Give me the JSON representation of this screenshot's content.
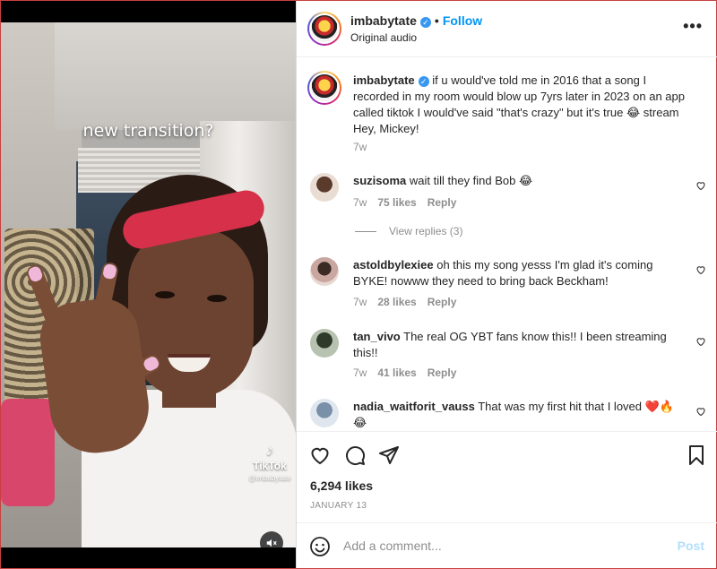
{
  "post": {
    "author": "imbabytate",
    "audio": "Original audio",
    "follow_label": "Follow",
    "dot": "•",
    "more_label": "•••"
  },
  "media": {
    "overlay_text": "new transition?",
    "watermark_brand": "TikTok",
    "watermark_user": "@imbabytate"
  },
  "caption": {
    "username": "imbabytate",
    "text": "if u would've told me in 2016 that a song I recorded in my room would blow up 7yrs later in 2023 on an app called tiktok I would've said \"that's crazy\" but it's true 😂 stream Hey, Mickey!",
    "time": "7w"
  },
  "comments": [
    {
      "username": "suzisoma",
      "text": "wait till they find Bob 😂",
      "time": "7w",
      "likes": "75 likes",
      "reply": "Reply"
    },
    {
      "username": "astoldbylexiee",
      "text": "oh this my song yesss I'm glad it's coming BYKE! nowww they need to bring back Beckham!",
      "time": "7w",
      "likes": "28 likes",
      "reply": "Reply"
    },
    {
      "username": "tan_vivo",
      "text": "The real OG YBT fans know this!! I been streaming this!!",
      "time": "7w",
      "likes": "41 likes",
      "reply": "Reply"
    },
    {
      "username": "nadia_waitforit_vauss",
      "text": "That was my first hit that I loved ❤️🔥😂",
      "time": "",
      "likes": "",
      "reply": ""
    }
  ],
  "view_replies": "View replies (3)",
  "stats": {
    "likes": "6,294 likes",
    "date": "JANUARY 13"
  },
  "composer": {
    "placeholder": "Add a comment...",
    "post_label": "Post"
  },
  "colors": {
    "accent": "#0095f6",
    "post_disabled": "#b2dffc",
    "verified": "#3897f0",
    "muted": "#8e8e8e"
  }
}
